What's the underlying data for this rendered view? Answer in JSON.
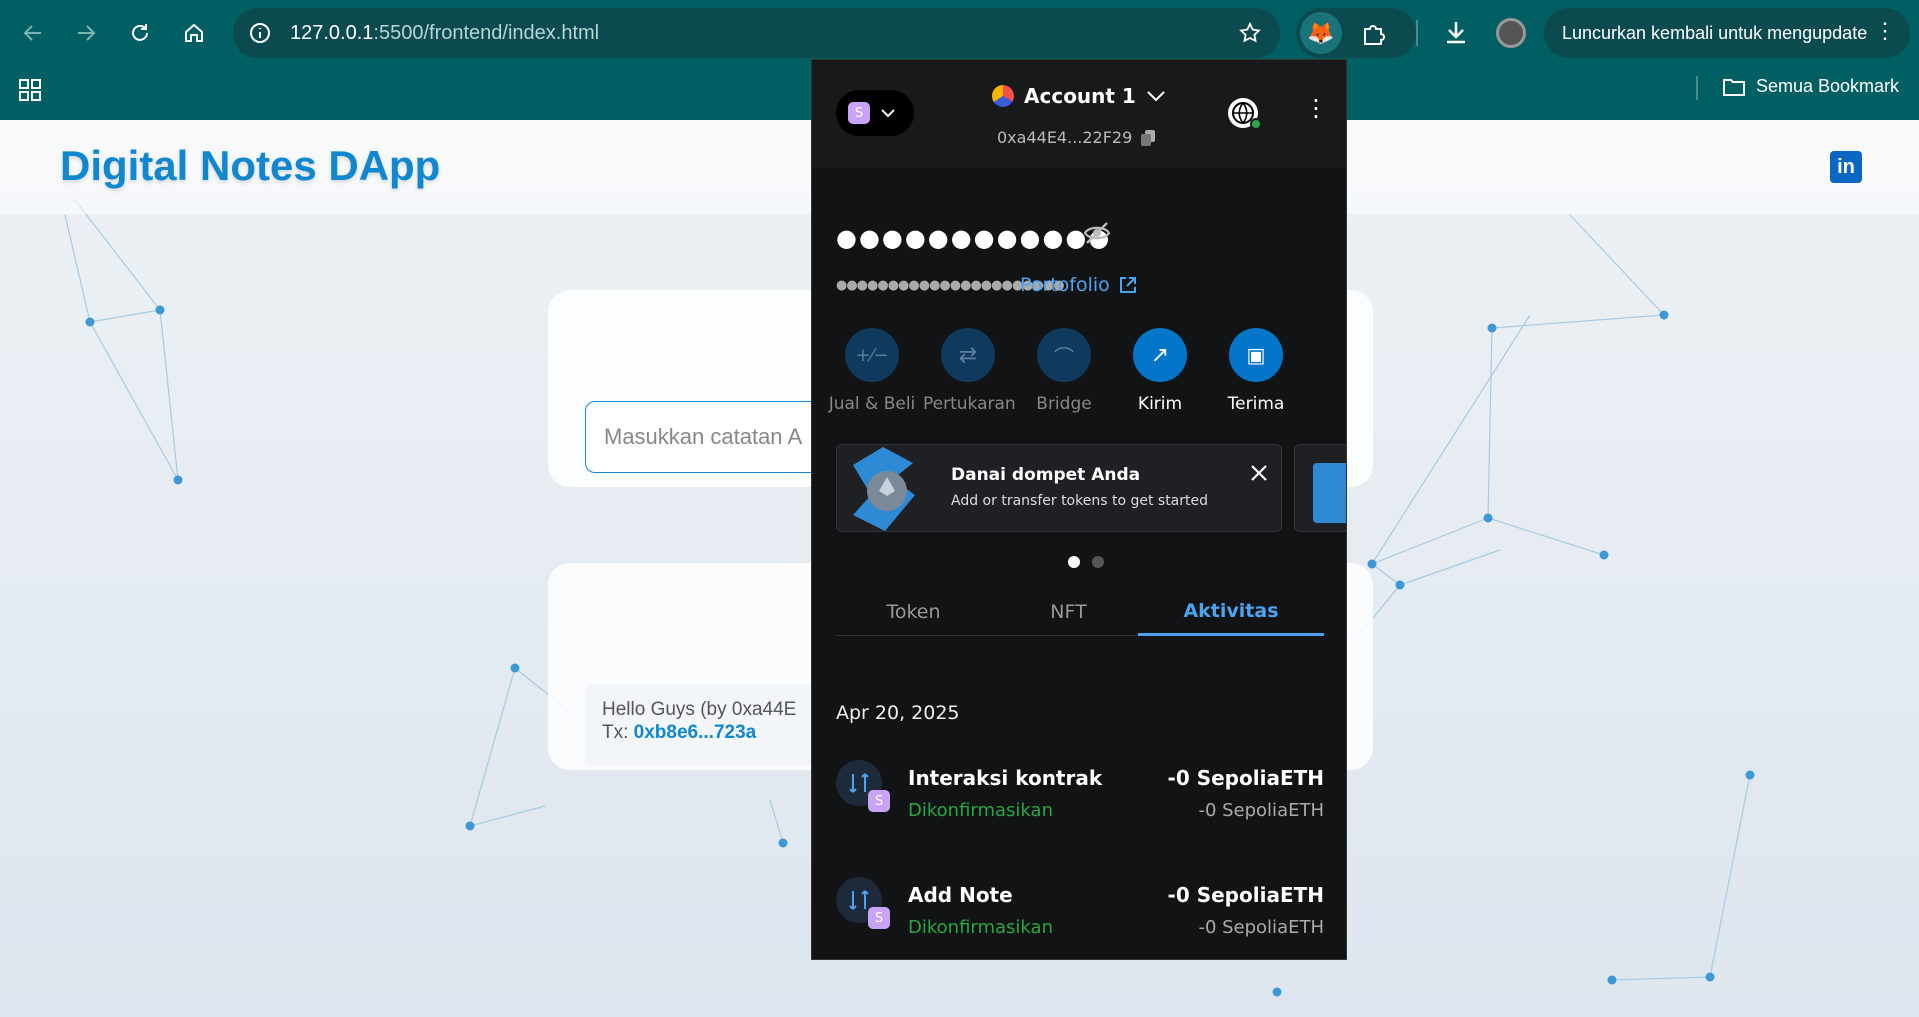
{
  "browser": {
    "url_host": "127.0.0.1",
    "url_rest": ":5500/frontend/index.html",
    "relaunch_label": "Luncurkan kembali untuk mengupdate",
    "bookmarks_label": "Semua Bookmark"
  },
  "page": {
    "title": "Digital Notes DApp",
    "note_placeholder": "Masukkan catatan A",
    "note_text": "Hello Guys (by 0xa44E",
    "note_tx_label": "Tx: ",
    "note_tx_hash": "0xb8e6...723a"
  },
  "metamask": {
    "network_badge": "S",
    "account_name": "Account 1",
    "account_address": "0xa44E4...22F29",
    "balance_hidden": "●●●●●●●●●●●●",
    "small_hidden": "●●●●●●●●●●●●●●●●●●●●●●",
    "portfolio_label": "Portofolio",
    "actions": [
      {
        "label": "Jual & Beli"
      },
      {
        "label": "Pertukaran"
      },
      {
        "label": "Bridge"
      },
      {
        "label": "Kirim"
      },
      {
        "label": "Terima"
      }
    ],
    "banner": {
      "title": "Danai dompet Anda",
      "subtitle": "Add or transfer tokens to get started"
    },
    "tabs": [
      "Token",
      "NFT",
      "Aktivitas"
    ],
    "active_tab": "Aktivitas",
    "activity_date": "Apr 20, 2025",
    "transactions": [
      {
        "title": "Interaksi kontrak",
        "status": "Dikonfirmasikan",
        "amount": "-0 SepoliaETH",
        "amount2": "-0 SepoliaETH"
      },
      {
        "title": "Add Note",
        "status": "Dikonfirmasikan",
        "amount": "-0 SepoliaETH",
        "amount2": "-0 SepoliaETH"
      }
    ]
  },
  "colors": {
    "chrome": "#005f63",
    "accent": "#1187cf",
    "mm_bg": "#121314",
    "mm_blue": "#4ba3f2",
    "confirmed": "#28a745"
  }
}
